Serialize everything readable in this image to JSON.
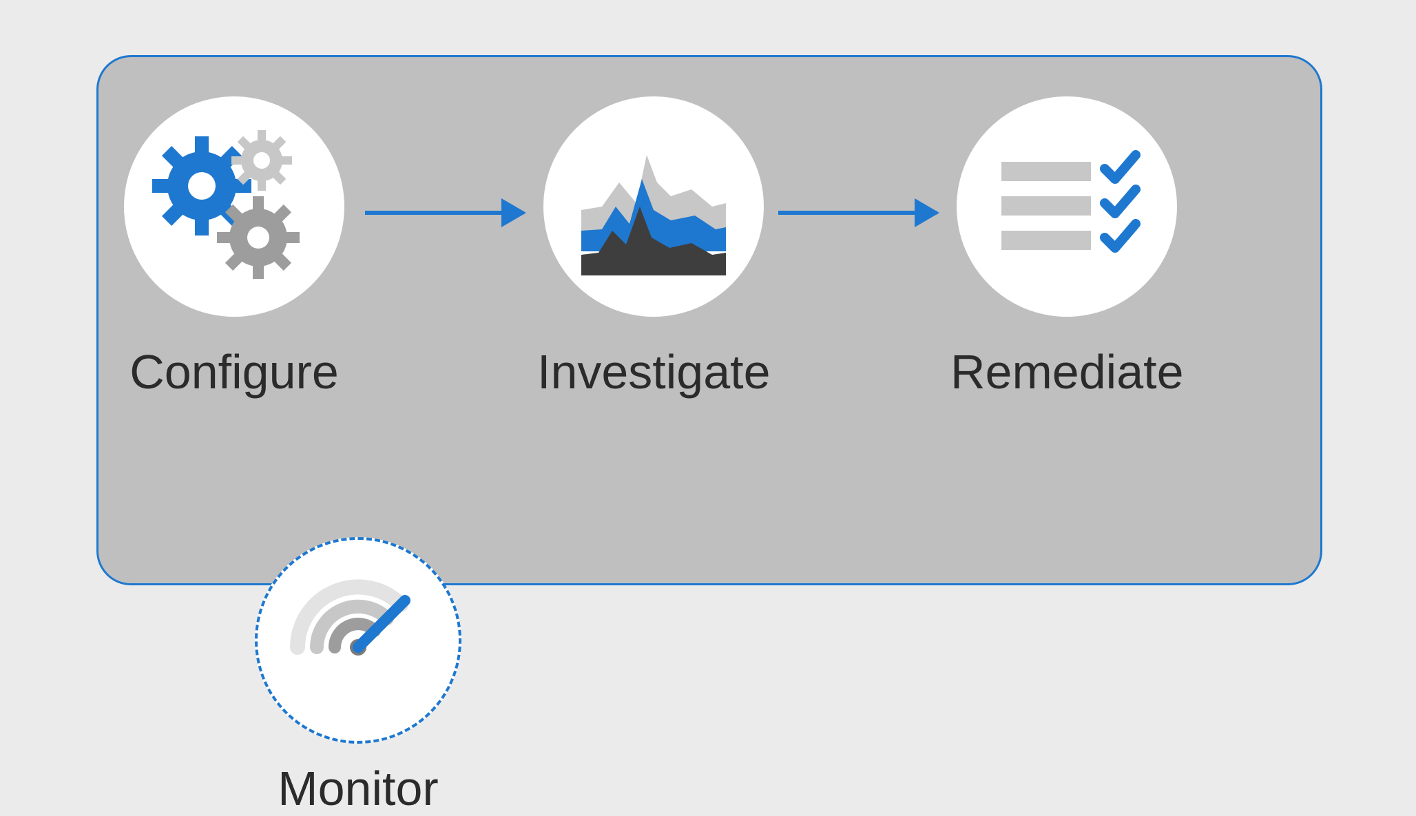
{
  "steps": {
    "configure": {
      "label": "Configure",
      "icon": "gears-icon"
    },
    "investigate": {
      "label": "Investigate",
      "icon": "chart-pulse-icon"
    },
    "remediate": {
      "label": "Remediate",
      "icon": "checklist-icon"
    },
    "monitor": {
      "label": "Monitor",
      "icon": "radar-target-icon"
    }
  },
  "colors": {
    "accent": "#1e78d0",
    "grayDark": "#3e3e3e",
    "grayMid": "#9d9d9d",
    "grayLight": "#c7c7c7",
    "panel": "#bfbfbf",
    "bg": "#ebebeb"
  },
  "flow": [
    "configure",
    "investigate",
    "remediate"
  ],
  "overlay": "monitor"
}
